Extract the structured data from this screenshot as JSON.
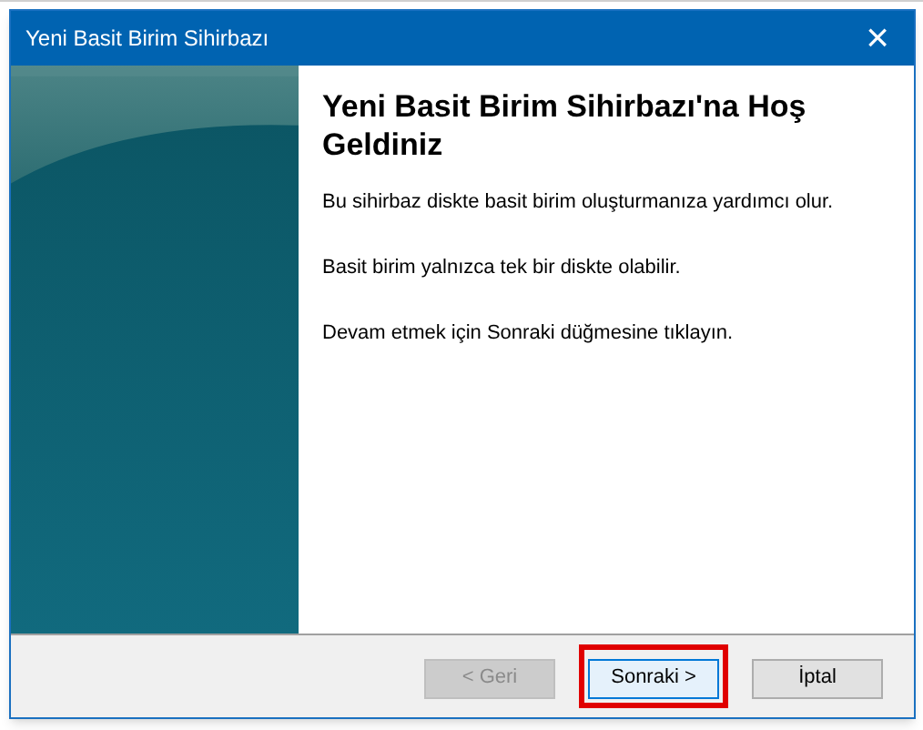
{
  "window": {
    "title": "Yeni Basit Birim Sihirbazı",
    "close": "×"
  },
  "heading": "Yeni Basit Birim Sihirbazı'na Hoş Geldiniz",
  "paragraphs": [
    "Bu sihirbaz diskte basit birim oluşturmanıza yardımcı olur.",
    "Basit birim yalnızca tek bir diskte olabilir.",
    "Devam etmek için Sonraki düğmesine tıklayın."
  ],
  "buttons": [
    {
      "label": "< Geri",
      "disabled": true,
      "highlighted": false,
      "focused": false
    },
    {
      "label": "Sonraki >",
      "disabled": false,
      "highlighted": true,
      "focused": true
    },
    {
      "label": "İptal",
      "disabled": false,
      "highlighted": false,
      "focused": false
    }
  ]
}
